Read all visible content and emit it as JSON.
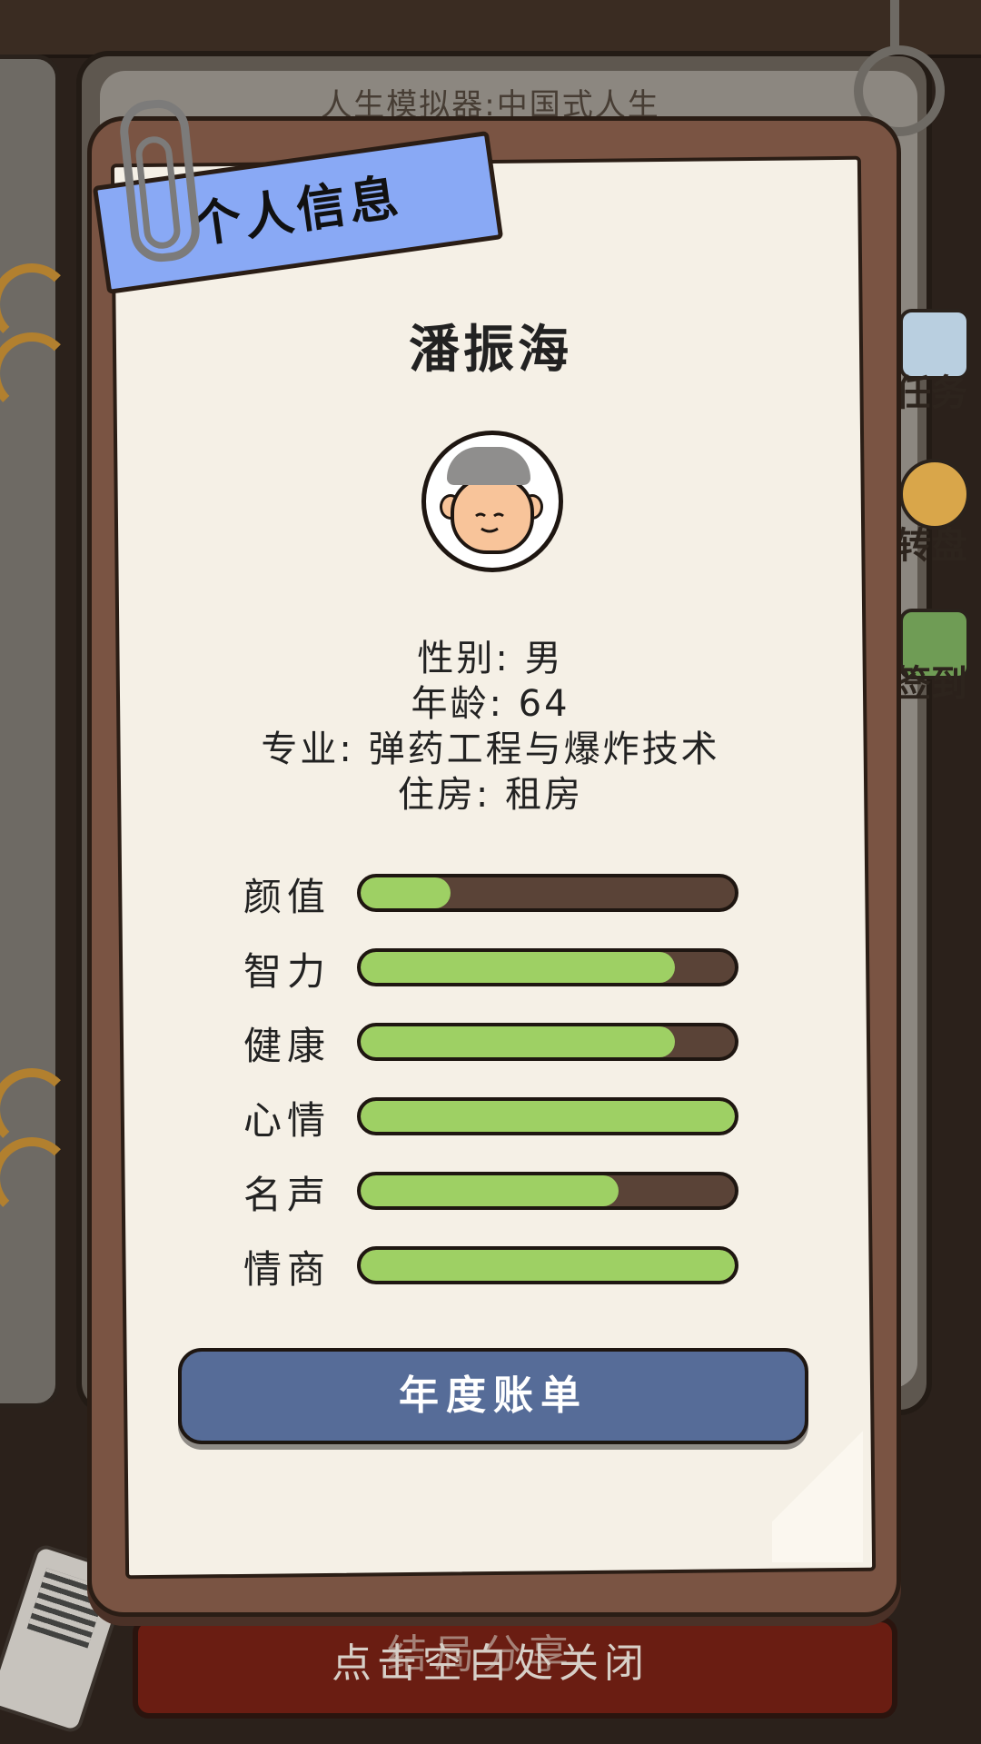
{
  "background": {
    "game_title": "人生模拟器:中国式人生",
    "side_menu": [
      {
        "label": "任务",
        "icon": "clipboard-icon"
      },
      {
        "label": "转盘",
        "icon": "wheel-icon"
      },
      {
        "label": "签到",
        "icon": "checkin-icon"
      }
    ],
    "bottom_book_title": "结局分享",
    "close_hint": "点击空白处关闭"
  },
  "panel": {
    "banner_title": "个人信息",
    "name": "潘振海",
    "avatar_icon": "elder-man-avatar-icon",
    "info": {
      "gender": "性别: 男",
      "age": "年龄: 64",
      "major": "专业: 弹药工程与爆炸技术",
      "housing": "住房: 租房"
    },
    "stats": [
      {
        "label": "颜值",
        "value": 0.24
      },
      {
        "label": "智力",
        "value": 0.84
      },
      {
        "label": "健康",
        "value": 0.84
      },
      {
        "label": "心情",
        "value": 1.0
      },
      {
        "label": "名声",
        "value": 0.69
      },
      {
        "label": "情商",
        "value": 1.0
      }
    ],
    "annual_bill_label": "年度账单"
  },
  "colors": {
    "banner": "#89a9f5",
    "bar_fill": "#9ed064",
    "bar_track": "#5a4337",
    "button": "#566c98",
    "paper": "#f5f0e6",
    "board": "#7a5443"
  }
}
